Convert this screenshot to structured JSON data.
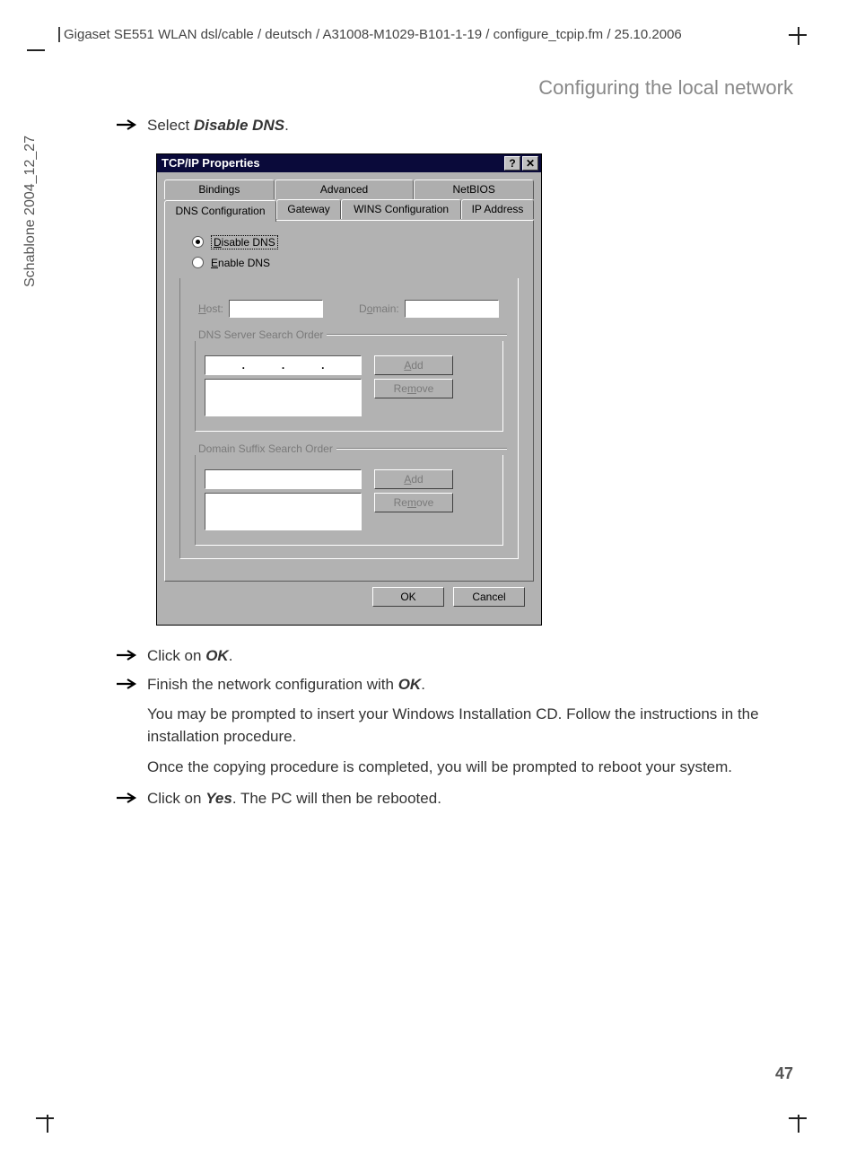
{
  "header": {
    "path": "Gigaset SE551 WLAN dsl/cable / deutsch / A31008-M1029-B101-1-19 / configure_tcpip.fm / 25.10.2006"
  },
  "section_title": "Configuring the local network",
  "sidebar_text": "Schablone 2004_12_27",
  "steps": {
    "s1_pre": "Select ",
    "s1_bold": "Disable DNS",
    "s1_post": ".",
    "s2_pre": "Click on ",
    "s2_bold": "OK",
    "s2_post": ".",
    "s3_pre": "Finish the network configuration with ",
    "s3_bold": "OK",
    "s3_post": ".",
    "p1": "You may be prompted to insert your Windows Installation CD. Follow the instructions in the installation procedure.",
    "p2": "Once the copying procedure is completed, you will be prompted to reboot your system.",
    "s4_pre": "Click on ",
    "s4_bold": "Yes",
    "s4_post": ". The PC will then be rebooted."
  },
  "dialog": {
    "title": "TCP/IP Properties",
    "help": "?",
    "close": "✕",
    "tabs_back": [
      "Bindings",
      "Advanced",
      "NetBIOS"
    ],
    "tabs_front": [
      "DNS Configuration",
      "Gateway",
      "WINS Configuration",
      "IP Address"
    ],
    "radio_disable_pre": "D",
    "radio_disable": "isable DNS",
    "radio_enable_pre": "E",
    "radio_enable": "nable DNS",
    "host_pre": "H",
    "host": "ost:",
    "domain_pre": "o",
    "domain_before": "D",
    "domain_after": "main:",
    "group1": "DNS Server Search Order",
    "group2": "Domain Suffix Search Order",
    "add_pre": "A",
    "add": "dd",
    "remove_pre": "m",
    "remove_before": "Re",
    "remove_after": "ove",
    "ok": "OK",
    "cancel": "Cancel"
  },
  "page_number": "47"
}
